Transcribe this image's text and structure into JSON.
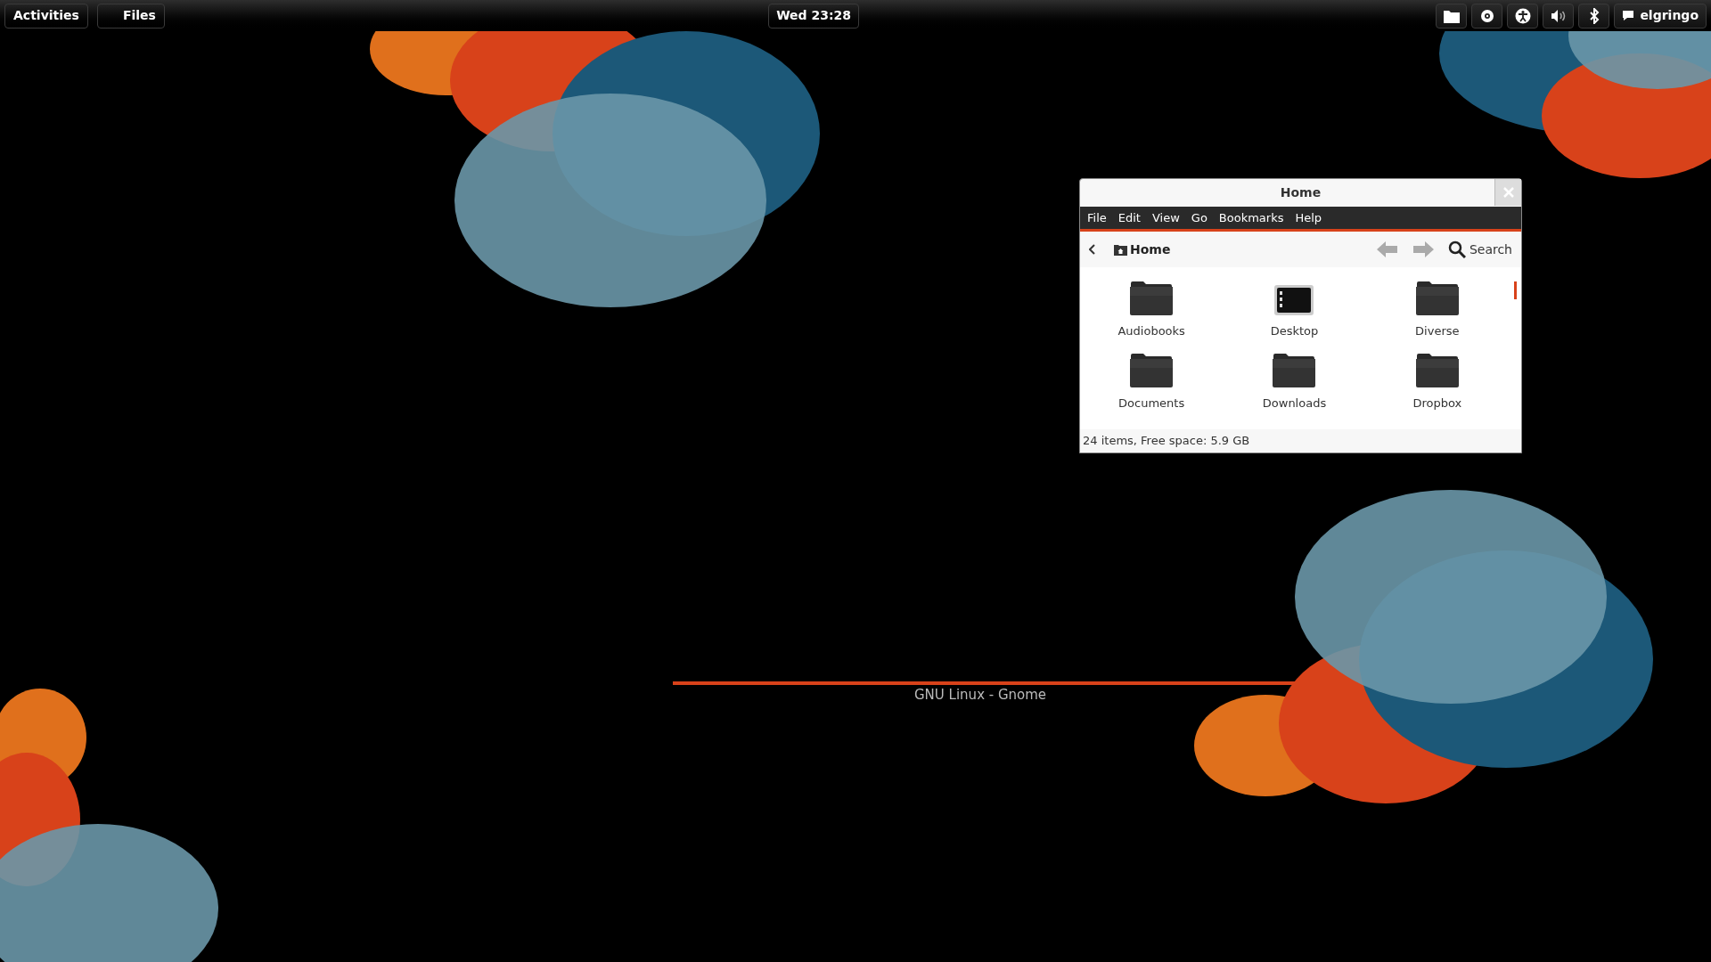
{
  "top_bar": {
    "activities": "Activities",
    "app_menu": "Files",
    "clock": "Wed 23:28",
    "user": "elgringo"
  },
  "wallpaper": {
    "caption": "GNU Linux - Gnome"
  },
  "window": {
    "title": "Home",
    "menu": [
      "File",
      "Edit",
      "View",
      "Go",
      "Bookmarks",
      "Help"
    ],
    "location": "Home",
    "search": "Search",
    "items": [
      {
        "name": "Audiobooks",
        "kind": "folder"
      },
      {
        "name": "Desktop",
        "kind": "desktop"
      },
      {
        "name": "Diverse",
        "kind": "folder"
      },
      {
        "name": "Documents",
        "kind": "folder"
      },
      {
        "name": "Downloads",
        "kind": "folder"
      },
      {
        "name": "Dropbox",
        "kind": "folder"
      }
    ],
    "status": "24 items, Free space: 5.9 GB"
  }
}
